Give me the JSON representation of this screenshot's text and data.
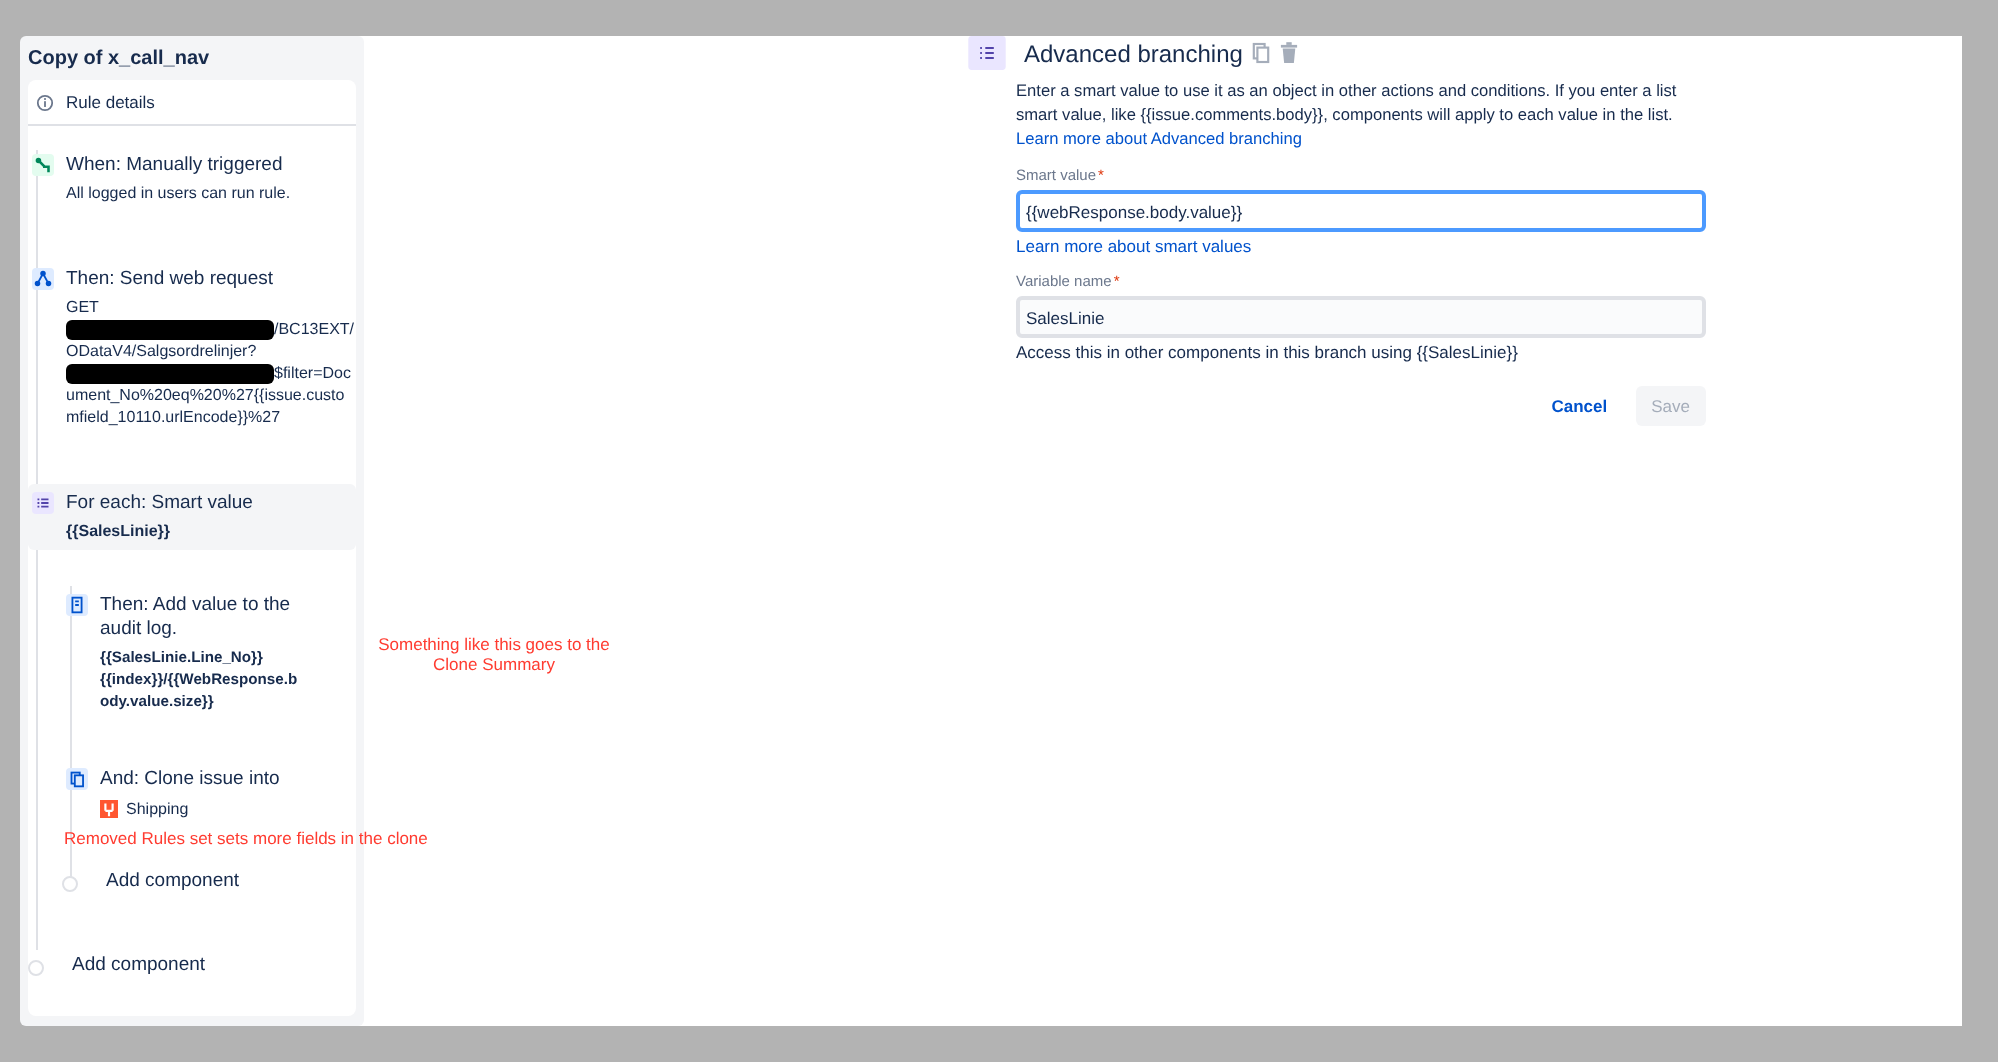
{
  "rule_title": "Copy of x_call_nav",
  "rule_details": "Rule details",
  "steps": [
    {
      "kind": "trigger",
      "title": "When: Manually triggered",
      "selected": false,
      "lines": [
        {
          "redacted": false,
          "text": "All logged in users can run rule.",
          "bold": false
        }
      ]
    },
    {
      "kind": "webrequest",
      "title": "Then: Send web request",
      "selected": false,
      "lines": [
        {
          "redacted": false,
          "text": "GET",
          "bold": false
        },
        {
          "redacted": true,
          "text": "/BC13EXT/",
          "bold": false
        },
        {
          "redacted": false,
          "text": "ODataV4/Salgsordrelinjer?",
          "bold": false
        },
        {
          "redacted": true,
          "text": "$filter=Doc",
          "bold": false
        },
        {
          "redacted": false,
          "text": "ument_No%20eq%20%27{{issue.custo",
          "bold": false
        },
        {
          "redacted": false,
          "text": "mfield_10110.urlEncode}}%27",
          "bold": false
        }
      ]
    },
    {
      "kind": "branch",
      "title": "For each: Smart value",
      "selected": true,
      "lines": [
        {
          "redacted": false,
          "text": "{{SalesLinie}}",
          "bold": true
        }
      ],
      "children": [
        {
          "kind": "log",
          "title": "Then: Add value to the audit log.",
          "selected": false,
          "lines": [
            {
              "text": "{{SalesLinie.Line_No}}",
              "bold": true
            },
            {
              "text": "{{index}}/{{WebResponse.body.value.size}}",
              "bold": true
            }
          ]
        },
        {
          "kind": "clone",
          "title": "And: Clone issue into",
          "selected": false,
          "project": "Shipping"
        },
        {
          "kind": "add",
          "title": "Add component",
          "selected": false
        }
      ]
    },
    {
      "kind": "add",
      "title": "Add component",
      "selected": false
    }
  ],
  "annotations": [
    "Something like this goes to the Clone Summary",
    "Removed Rules set sets more fields in the  clone"
  ],
  "panel": {
    "title": "Advanced branching",
    "description": "Enter a smart value to use it as an object in other actions and conditions. If you enter a list smart value, like {{issue.comments.body}}, components will apply to each value in the list.",
    "description_link": "Learn more about Advanced branching",
    "fields": [
      {
        "label": "Smart value",
        "required_mark": "*",
        "value": "{{webResponse.body.value}}",
        "focused": true,
        "link": "Learn more about smart values"
      },
      {
        "label": "Variable name",
        "required_mark": "*",
        "value": "SalesLinie",
        "focused": false,
        "help": "Access this in other components in this branch using {{SalesLinie}}"
      }
    ],
    "buttons": [
      {
        "label": "Cancel",
        "kind": "link",
        "disabled": false
      },
      {
        "label": "Save",
        "kind": "primary",
        "disabled": true
      }
    ]
  }
}
